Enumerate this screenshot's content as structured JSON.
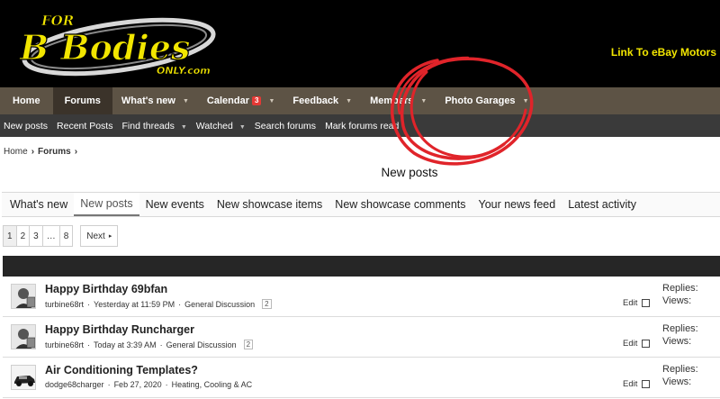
{
  "header": {
    "logo": {
      "line1": "FOR",
      "line2": "B Bodies",
      "line3": "ONLY.com"
    },
    "ebay_link": "Link To eBay Motors"
  },
  "nav": {
    "home": "Home",
    "forums": "Forums",
    "whats_new": "What's new",
    "calendar": "Calendar",
    "calendar_badge": "3",
    "feedback": "Feedback",
    "members": "Members",
    "photo_garages": "Photo Garages"
  },
  "subnav": {
    "new_posts": "New posts",
    "recent_posts": "Recent Posts",
    "find_threads": "Find threads",
    "watched": "Watched",
    "search_forums": "Search forums",
    "mark_read": "Mark forums read"
  },
  "breadcrumb": {
    "home": "Home",
    "forums": "Forums"
  },
  "page_title": "New posts",
  "tabs": {
    "whats_new": "What's new",
    "new_posts": "New posts",
    "new_events": "New events",
    "new_showcase_items": "New showcase items",
    "new_showcase_comments": "New showcase comments",
    "your_news_feed": "Your news feed",
    "latest_activity": "Latest activity"
  },
  "pagination": {
    "p1": "1",
    "p2": "2",
    "p3": "3",
    "ellipsis": "…",
    "p8": "8",
    "next": "Next"
  },
  "threads": [
    {
      "title": "Happy Birthday 69bfan",
      "author": "turbine68rt",
      "date": "Yesterday at 11:59 PM",
      "forum": "General Discussion",
      "pages": "2",
      "edit": "Edit",
      "replies_label": "Replies:",
      "views_label": "Views:"
    },
    {
      "title": "Happy Birthday Runcharger",
      "author": "turbine68rt",
      "date": "Today at 3:39 AM",
      "forum": "General Discussion",
      "pages": "2",
      "edit": "Edit",
      "replies_label": "Replies:",
      "views_label": "Views:"
    },
    {
      "title": "Air Conditioning Templates?",
      "author": "dodge68charger",
      "date": "Feb 27, 2020",
      "forum": "Heating, Cooling & AC",
      "pages": "",
      "edit": "Edit",
      "replies_label": "Replies:",
      "views_label": "Views:"
    }
  ],
  "colors": {
    "header_bg": "#000000",
    "nav_bg": "#5d5345",
    "nav_selected": "#3b332a",
    "subnav_bg": "#3a3a3a",
    "logo_yellow": "#f2e600",
    "annotation_red": "#e0242a"
  }
}
